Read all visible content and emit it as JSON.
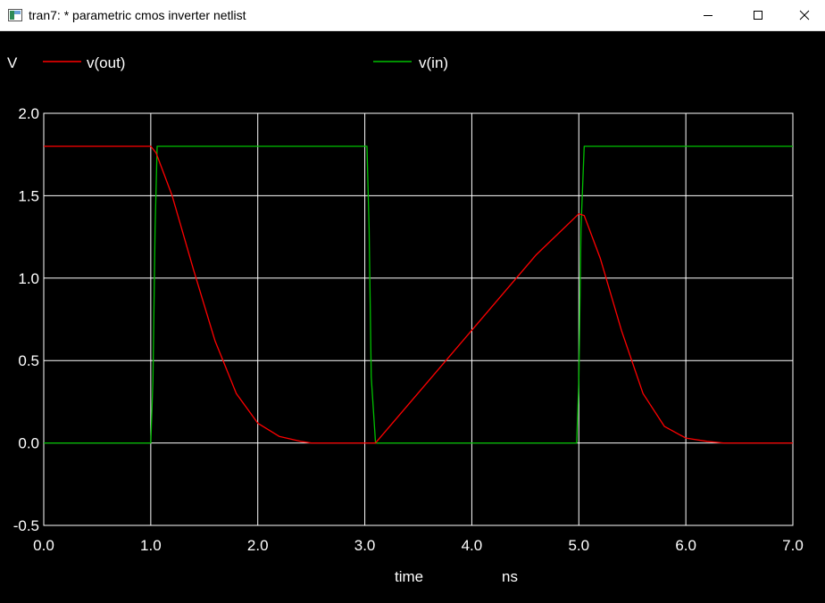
{
  "window": {
    "title": "tran7: * parametric cmos inverter netlist",
    "controls": [
      "minimize-icon",
      "maximize-icon",
      "close-icon"
    ]
  },
  "colors": {
    "background": "#000000",
    "grid": "#ffffff",
    "text": "#ffffff",
    "vout": "#ff0000",
    "vin": "#00c000"
  },
  "chart_data": {
    "type": "line",
    "title": "",
    "ylabel": "V",
    "xlabel": "time",
    "xunit": "ns",
    "xlim": [
      0,
      7
    ],
    "ylim": [
      -0.5,
      2
    ],
    "xticks": [
      "0.0",
      "1.0",
      "2.0",
      "3.0",
      "4.0",
      "5.0",
      "6.0",
      "7.0"
    ],
    "yticks": [
      "2.0",
      "1.5",
      "1.0",
      "0.5",
      "0.0",
      "-0.5"
    ],
    "grid": true,
    "legend_position": "top",
    "series": [
      {
        "name": "v(out)",
        "color": "#ff0000",
        "x": [
          0,
          1.0,
          1.05,
          1.2,
          1.4,
          1.6,
          1.8,
          2.0,
          2.2,
          2.4,
          2.5,
          3.1,
          3.6,
          4.1,
          4.6,
          5.0,
          5.05,
          5.2,
          5.4,
          5.6,
          5.8,
          6.0,
          6.2,
          6.35,
          7.0
        ],
        "y": [
          1.8,
          1.8,
          1.76,
          1.5,
          1.05,
          0.62,
          0.3,
          0.12,
          0.04,
          0.01,
          0.0,
          0.0,
          0.38,
          0.76,
          1.14,
          1.39,
          1.38,
          1.12,
          0.68,
          0.3,
          0.1,
          0.03,
          0.01,
          0.0,
          0.0
        ]
      },
      {
        "name": "v(in)",
        "color": "#00c000",
        "x": [
          0,
          1.0,
          1.02,
          1.04,
          1.06,
          3.02,
          3.04,
          3.06,
          3.1,
          4.98,
          5.0,
          5.02,
          5.05,
          7.0
        ],
        "y": [
          0.0,
          0.0,
          0.38,
          1.3,
          1.8,
          1.8,
          1.3,
          0.4,
          0.0,
          0.0,
          0.38,
          1.3,
          1.8,
          1.8
        ]
      }
    ]
  }
}
